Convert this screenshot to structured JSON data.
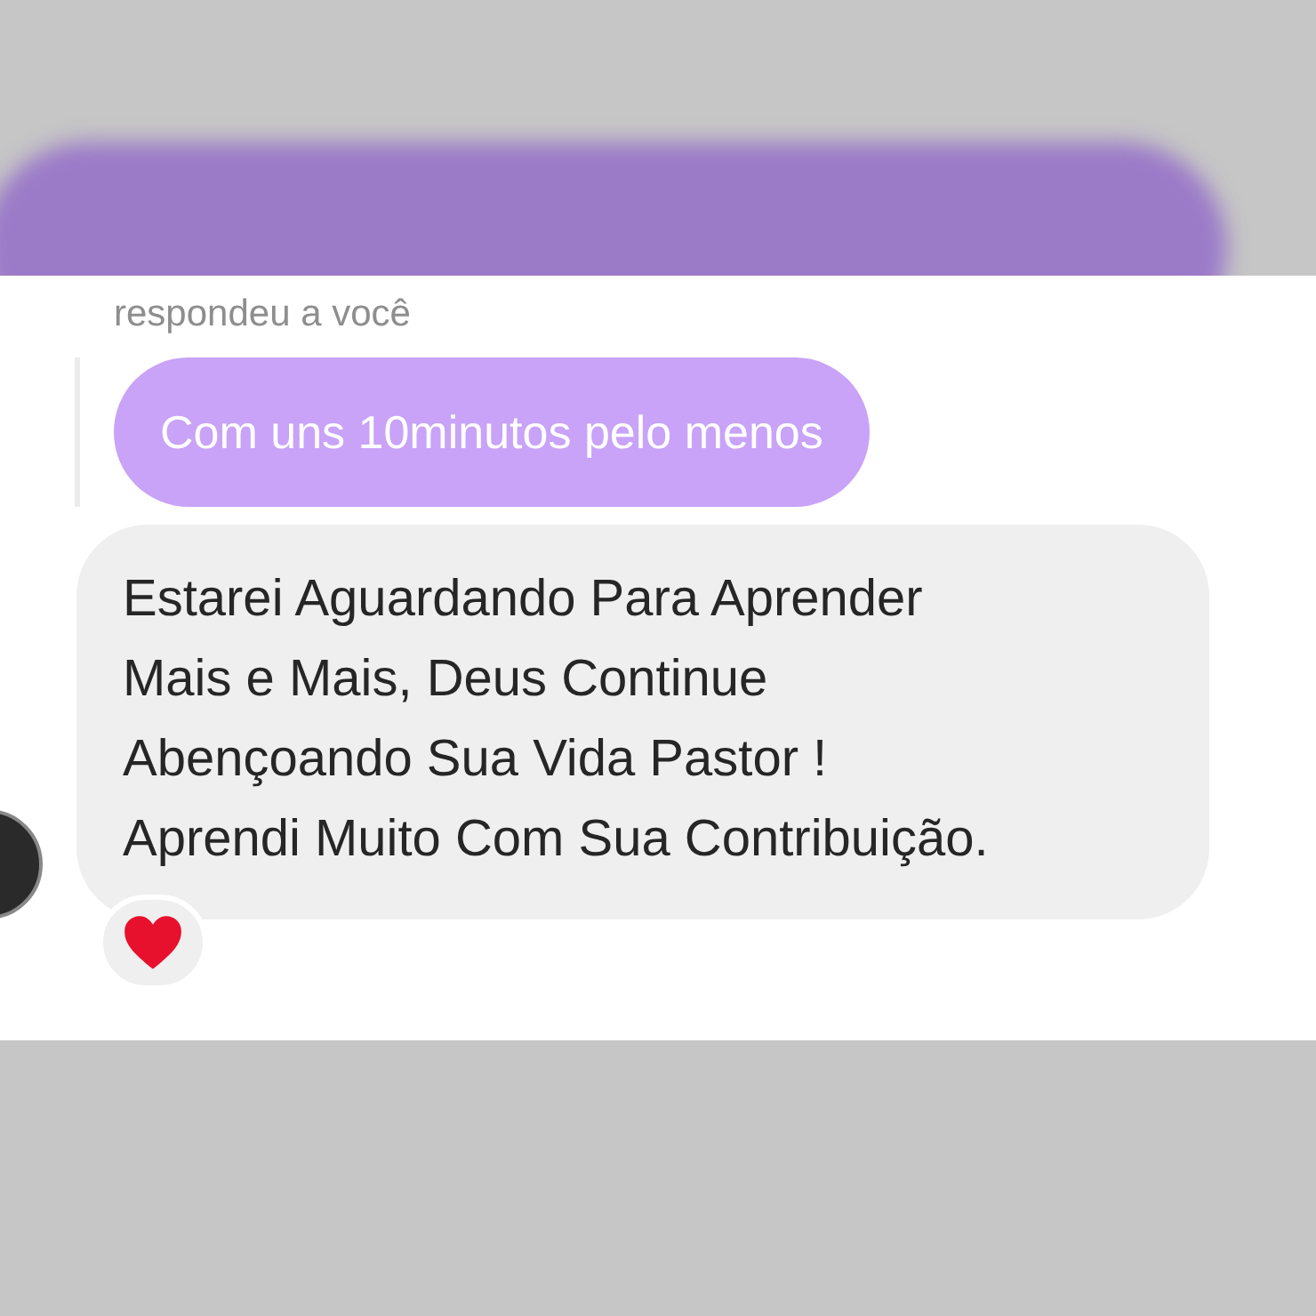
{
  "reply_header": "respondeu a você",
  "replied_message": "Com uns 10minutos pelo menos",
  "message": {
    "lines": [
      "Estarei Aguardando Para Aprender",
      "Mais e Mais, Deus Continue",
      "Abençoando Sua Vida Pastor !",
      "Aprendi Muito Com Sua Contribuição."
    ]
  }
}
